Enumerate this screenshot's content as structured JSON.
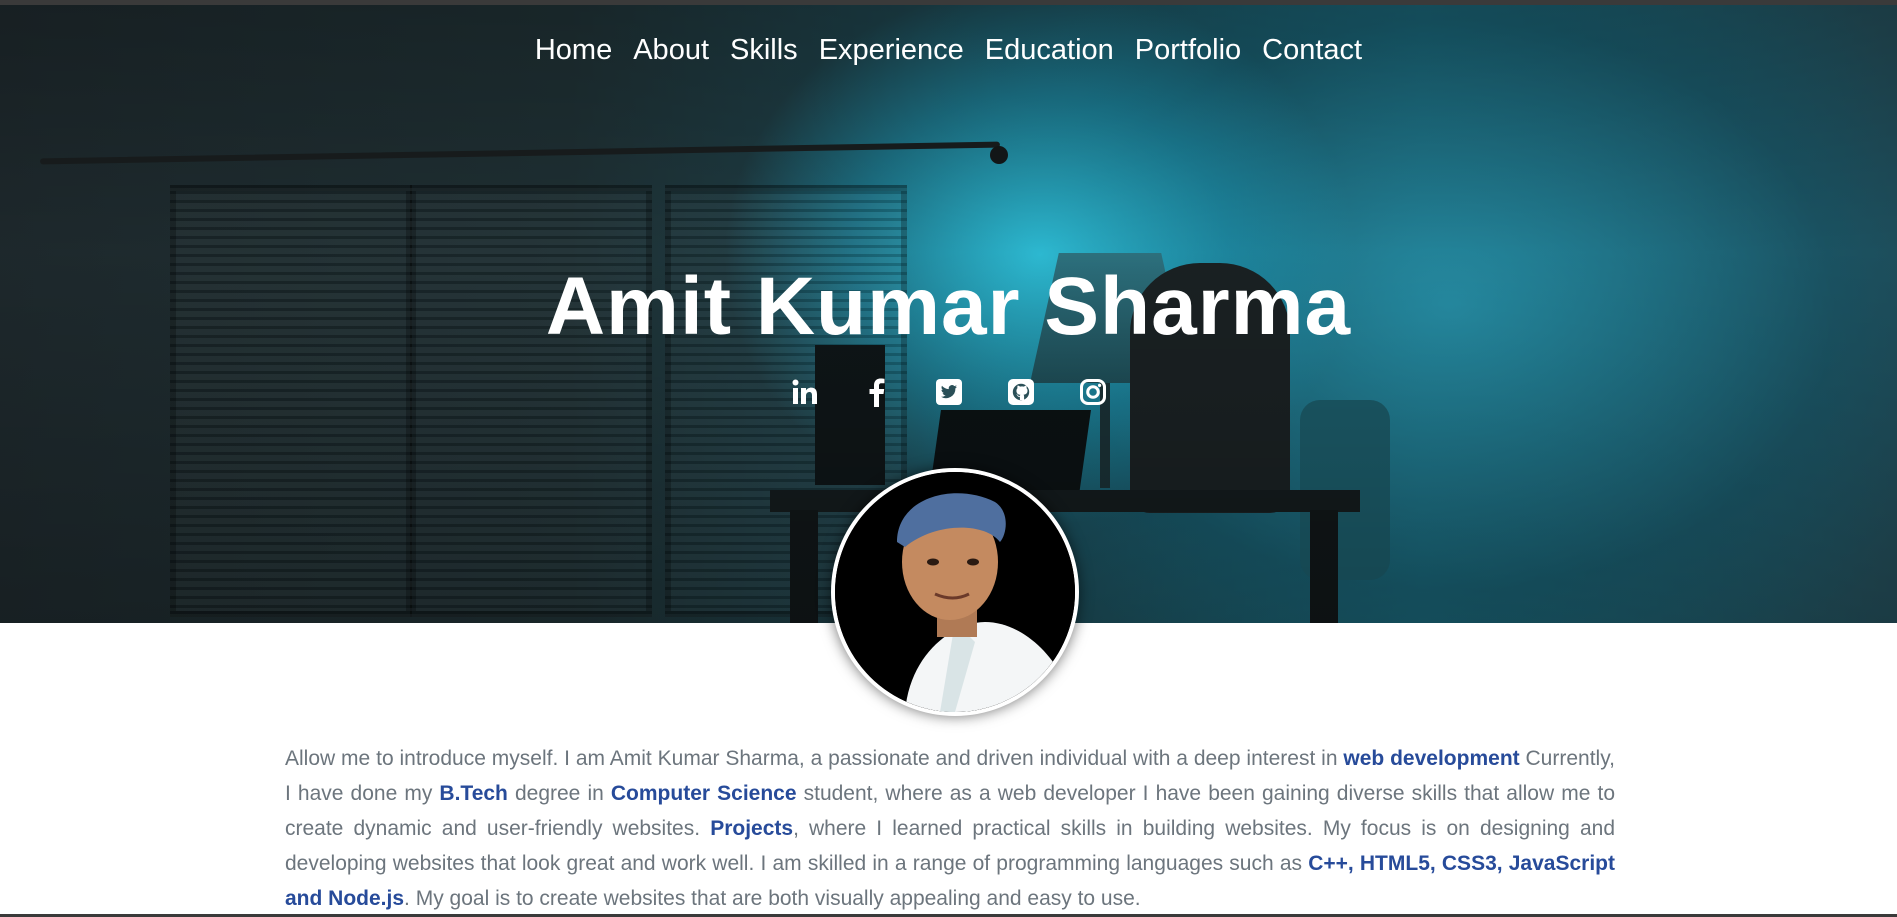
{
  "nav": {
    "items": [
      "Home",
      "About",
      "Skills",
      "Experience",
      "Education",
      "Portfolio",
      "Contact"
    ]
  },
  "hero": {
    "title": "Amit Kumar Sharma",
    "social_icons": [
      "linkedin-icon",
      "facebook-icon",
      "twitter-icon",
      "github-icon",
      "instagram-icon"
    ]
  },
  "about": {
    "t1": "Allow me to introduce myself. I am Amit Kumar Sharma, a passionate and driven individual with a deep interest in ",
    "h1": "web development",
    "t2": " Currently, I have done my ",
    "h2": "B.Tech",
    "t3": " degree in ",
    "h3": "Computer Science",
    "t4": " student, where as a web developer I have been gaining diverse skills that allow me to create dynamic and user-friendly websites. ",
    "h4": "Projects",
    "t5": ", where I learned practical skills in building websites. My focus is on designing and developing websites that look great and work well. I am skilled in a range of programming languages such as ",
    "h5": "C++, HTML5, CSS3, JavaScript and Node.js",
    "t6": ". My goal is to create websites that are both visually appealing and easy to use."
  },
  "colors": {
    "highlight": "#274b9a",
    "body_text": "#6c757d",
    "hero_accent": "#2fb8cf"
  }
}
